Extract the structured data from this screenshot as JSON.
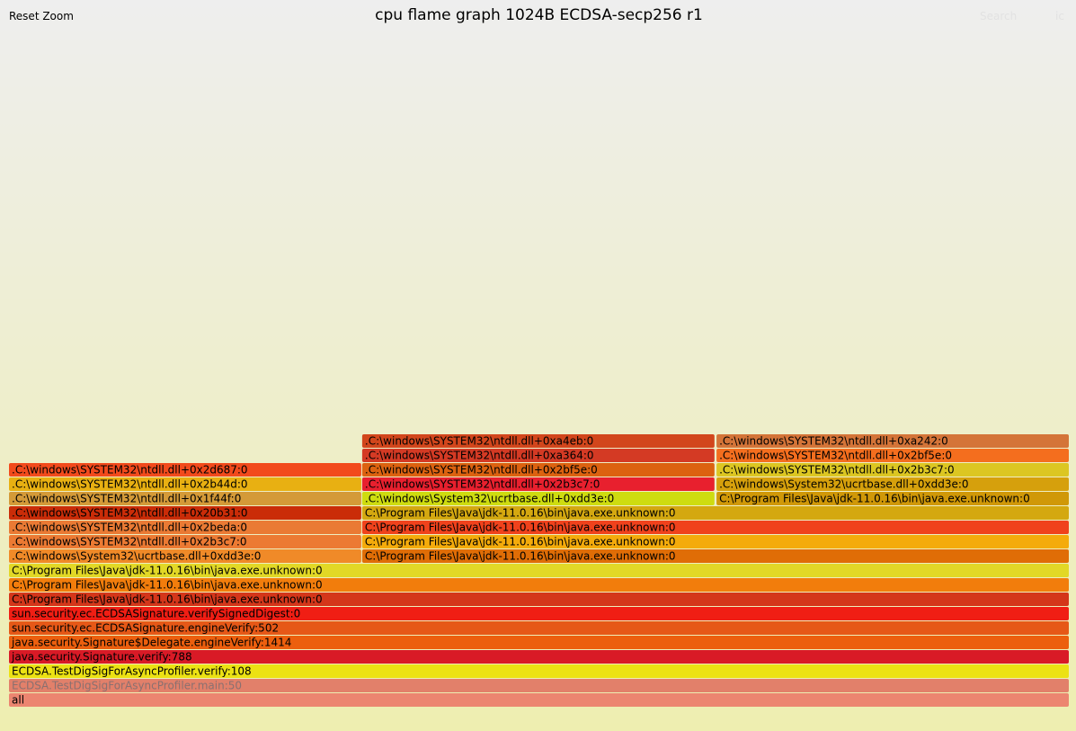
{
  "header": {
    "reset_zoom_label": "Reset Zoom",
    "title": "cpu flame graph 1024B ECDSA-secp256 r1",
    "search_label": "Search",
    "ic_label": "ic"
  },
  "chart_data": {
    "type": "flame graph",
    "title": "cpu flame graph 1024B ECDSA-secp256 r1",
    "total_width": 1,
    "depth_count": 19,
    "frames": [
      {
        "name": "all",
        "depth": 0,
        "start": 0.0,
        "width": 1.0,
        "color": "#ec8570"
      },
      {
        "name": "ECDSA.TestDigSigForAsyncProfiler.main:50",
        "depth": 1,
        "start": 0.0,
        "width": 1.0,
        "color": "#e2806a",
        "dim": true
      },
      {
        "name": "ECDSA.TestDigSigForAsyncProfiler.verify:108",
        "depth": 2,
        "start": 0.0,
        "width": 1.0,
        "color": "#ece213"
      },
      {
        "name": "java.security.Signature.verify:788",
        "depth": 3,
        "start": 0.0,
        "width": 1.0,
        "color": "#d91a26"
      },
      {
        "name": "java.security.Signature$Delegate.engineVerify:1414",
        "depth": 4,
        "start": 0.0,
        "width": 1.0,
        "color": "#ec5f0e"
      },
      {
        "name": "sun.security.ec.ECDSASignature.engineVerify:502",
        "depth": 5,
        "start": 0.0,
        "width": 1.0,
        "color": "#e65817"
      },
      {
        "name": "sun.security.ec.ECDSASignature.verifySignedDigest:0",
        "depth": 6,
        "start": 0.0,
        "width": 1.0,
        "color": "#f01e14"
      },
      {
        "name": "C:\\Program Files\\Java\\jdk-11.0.16\\bin\\java.exe.unknown:0",
        "depth": 7,
        "start": 0.0,
        "width": 1.0,
        "color": "#d4361a"
      },
      {
        "name": "C:\\Program Files\\Java\\jdk-11.0.16\\bin\\java.exe.unknown:0",
        "depth": 8,
        "start": 0.0,
        "width": 1.0,
        "color": "#f27d0c"
      },
      {
        "name": "C:\\Program Files\\Java\\jdk-11.0.16\\bin\\java.exe.unknown:0",
        "depth": 9,
        "start": 0.0,
        "width": 1.0,
        "color": "#e2d826"
      },
      {
        "name": ".C:\\windows\\System32\\ucrtbase.dll+0xdd3e:0",
        "depth": 10,
        "start": 0.0,
        "width": 0.333,
        "color": "#f08a28"
      },
      {
        "name": "C:\\Program Files\\Java\\jdk-11.0.16\\bin\\java.exe.unknown:0",
        "depth": 10,
        "start": 0.333,
        "width": 0.667,
        "color": "#e06d06"
      },
      {
        "name": ".C:\\windows\\SYSTEM32\\ntdll.dll+0x2b3c7:0",
        "depth": 11,
        "start": 0.0,
        "width": 0.333,
        "color": "#ec7a33"
      },
      {
        "name": "C:\\Program Files\\Java\\jdk-11.0.16\\bin\\java.exe.unknown:0",
        "depth": 11,
        "start": 0.333,
        "width": 0.667,
        "color": "#f4ab0b"
      },
      {
        "name": ".C:\\windows\\SYSTEM32\\ntdll.dll+0x2beda:0",
        "depth": 12,
        "start": 0.0,
        "width": 0.333,
        "color": "#ea7a34"
      },
      {
        "name": "C:\\Program Files\\Java\\jdk-11.0.16\\bin\\java.exe.unknown:0",
        "depth": 12,
        "start": 0.333,
        "width": 0.667,
        "color": "#f0421c"
      },
      {
        "name": ".C:\\windows\\SYSTEM32\\ntdll.dll+0x20b31:0",
        "depth": 13,
        "start": 0.0,
        "width": 0.333,
        "color": "#ca2c08"
      },
      {
        "name": "C:\\Program Files\\Java\\jdk-11.0.16\\bin\\java.exe.unknown:0",
        "depth": 13,
        "start": 0.333,
        "width": 0.667,
        "color": "#d4a810"
      },
      {
        "name": ".C:\\windows\\SYSTEM32\\ntdll.dll+0x1f44f:0",
        "depth": 14,
        "start": 0.0,
        "width": 0.333,
        "color": "#d49a38"
      },
      {
        "name": ".C:\\windows\\System32\\ucrtbase.dll+0xdd3e:0",
        "depth": 14,
        "start": 0.333,
        "width": 0.333,
        "color": "#cedc10"
      },
      {
        "name": "C:\\Program Files\\Java\\jdk-11.0.16\\bin\\java.exe.unknown:0",
        "depth": 14,
        "start": 0.667,
        "width": 0.333,
        "color": "#d09808"
      },
      {
        "name": ".C:\\windows\\SYSTEM32\\ntdll.dll+0x2b44d:0",
        "depth": 15,
        "start": 0.0,
        "width": 0.333,
        "color": "#e8b012"
      },
      {
        "name": ".C:\\windows\\SYSTEM32\\ntdll.dll+0x2b3c7:0",
        "depth": 15,
        "start": 0.333,
        "width": 0.333,
        "color": "#e8202e"
      },
      {
        "name": ".C:\\windows\\System32\\ucrtbase.dll+0xdd3e:0",
        "depth": 15,
        "start": 0.667,
        "width": 0.333,
        "color": "#d6a00c"
      },
      {
        "name": ".C:\\windows\\SYSTEM32\\ntdll.dll+0x2d687:0",
        "depth": 16,
        "start": 0.0,
        "width": 0.333,
        "color": "#f24a1c"
      },
      {
        "name": ".C:\\windows\\SYSTEM32\\ntdll.dll+0x2bf5e:0",
        "depth": 16,
        "start": 0.333,
        "width": 0.333,
        "color": "#dc6210"
      },
      {
        "name": ".C:\\windows\\SYSTEM32\\ntdll.dll+0x2b3c7:0",
        "depth": 16,
        "start": 0.667,
        "width": 0.333,
        "color": "#dcc622"
      },
      {
        "name": ".C:\\windows\\SYSTEM32\\ntdll.dll+0xa364:0",
        "depth": 17,
        "start": 0.333,
        "width": 0.333,
        "color": "#d43a24"
      },
      {
        "name": ".C:\\windows\\SYSTEM32\\ntdll.dll+0x2bf5e:0",
        "depth": 17,
        "start": 0.667,
        "width": 0.333,
        "color": "#f46e1e"
      },
      {
        "name": ".C:\\windows\\SYSTEM32\\ntdll.dll+0xa4eb:0",
        "depth": 18,
        "start": 0.333,
        "width": 0.333,
        "color": "#d2461c"
      },
      {
        "name": ".C:\\windows\\SYSTEM32\\ntdll.dll+0xa242:0",
        "depth": 18,
        "start": 0.667,
        "width": 0.333,
        "color": "#d47438"
      }
    ]
  }
}
